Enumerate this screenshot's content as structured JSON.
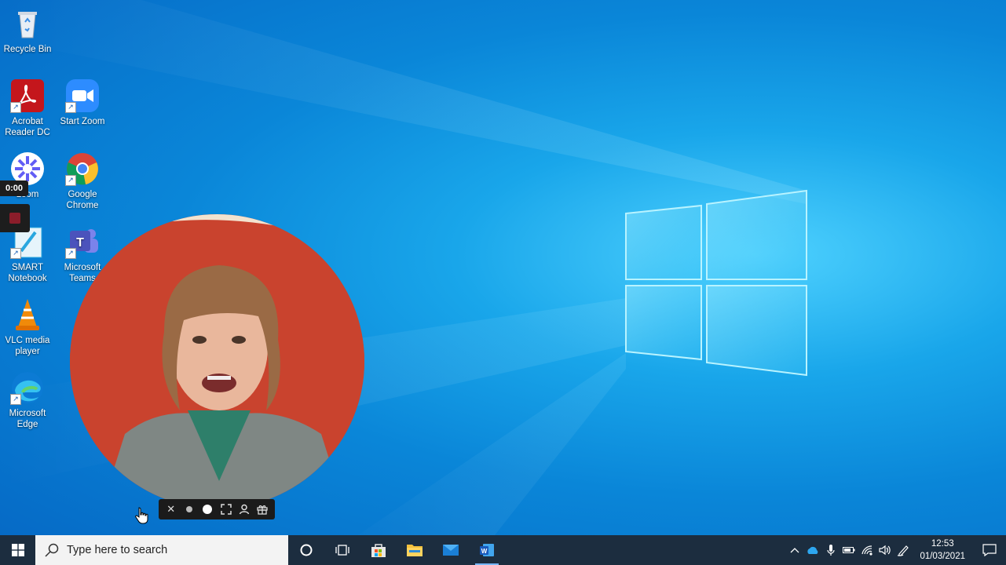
{
  "desktop": {
    "icons": [
      {
        "label": "Recycle Bin",
        "icon": "recycle-bin-icon"
      },
      {
        "label": "Acrobat Reader DC",
        "icon": "acrobat-icon"
      },
      {
        "label": "Start Zoom",
        "icon": "zoom-icon"
      },
      {
        "label": "Loom",
        "icon": "loom-icon"
      },
      {
        "label": "Google Chrome",
        "icon": "chrome-icon"
      },
      {
        "label": "SMART Notebook",
        "icon": "smart-notebook-icon"
      },
      {
        "label": "Microsoft Teams",
        "icon": "teams-icon"
      },
      {
        "label": "VLC media player",
        "icon": "vlc-icon"
      },
      {
        "label": "Microsoft Edge",
        "icon": "edge-icon"
      }
    ]
  },
  "recorder": {
    "timer": "0:00",
    "toolbar_icons": [
      "close-icon",
      "small-dot-icon",
      "large-dot-icon",
      "fullscreen-icon",
      "person-icon",
      "gift-icon"
    ]
  },
  "taskbar": {
    "search_placeholder": "Type here to search",
    "apps": [
      "cortana-icon",
      "task-view-icon",
      "store-icon",
      "file-explorer-icon",
      "mail-icon",
      "word-icon"
    ],
    "clock_time": "12:53",
    "clock_date": "01/03/2021",
    "colors": {
      "taskbar": "#1c2d3f",
      "accent": "#77b7ff"
    }
  }
}
